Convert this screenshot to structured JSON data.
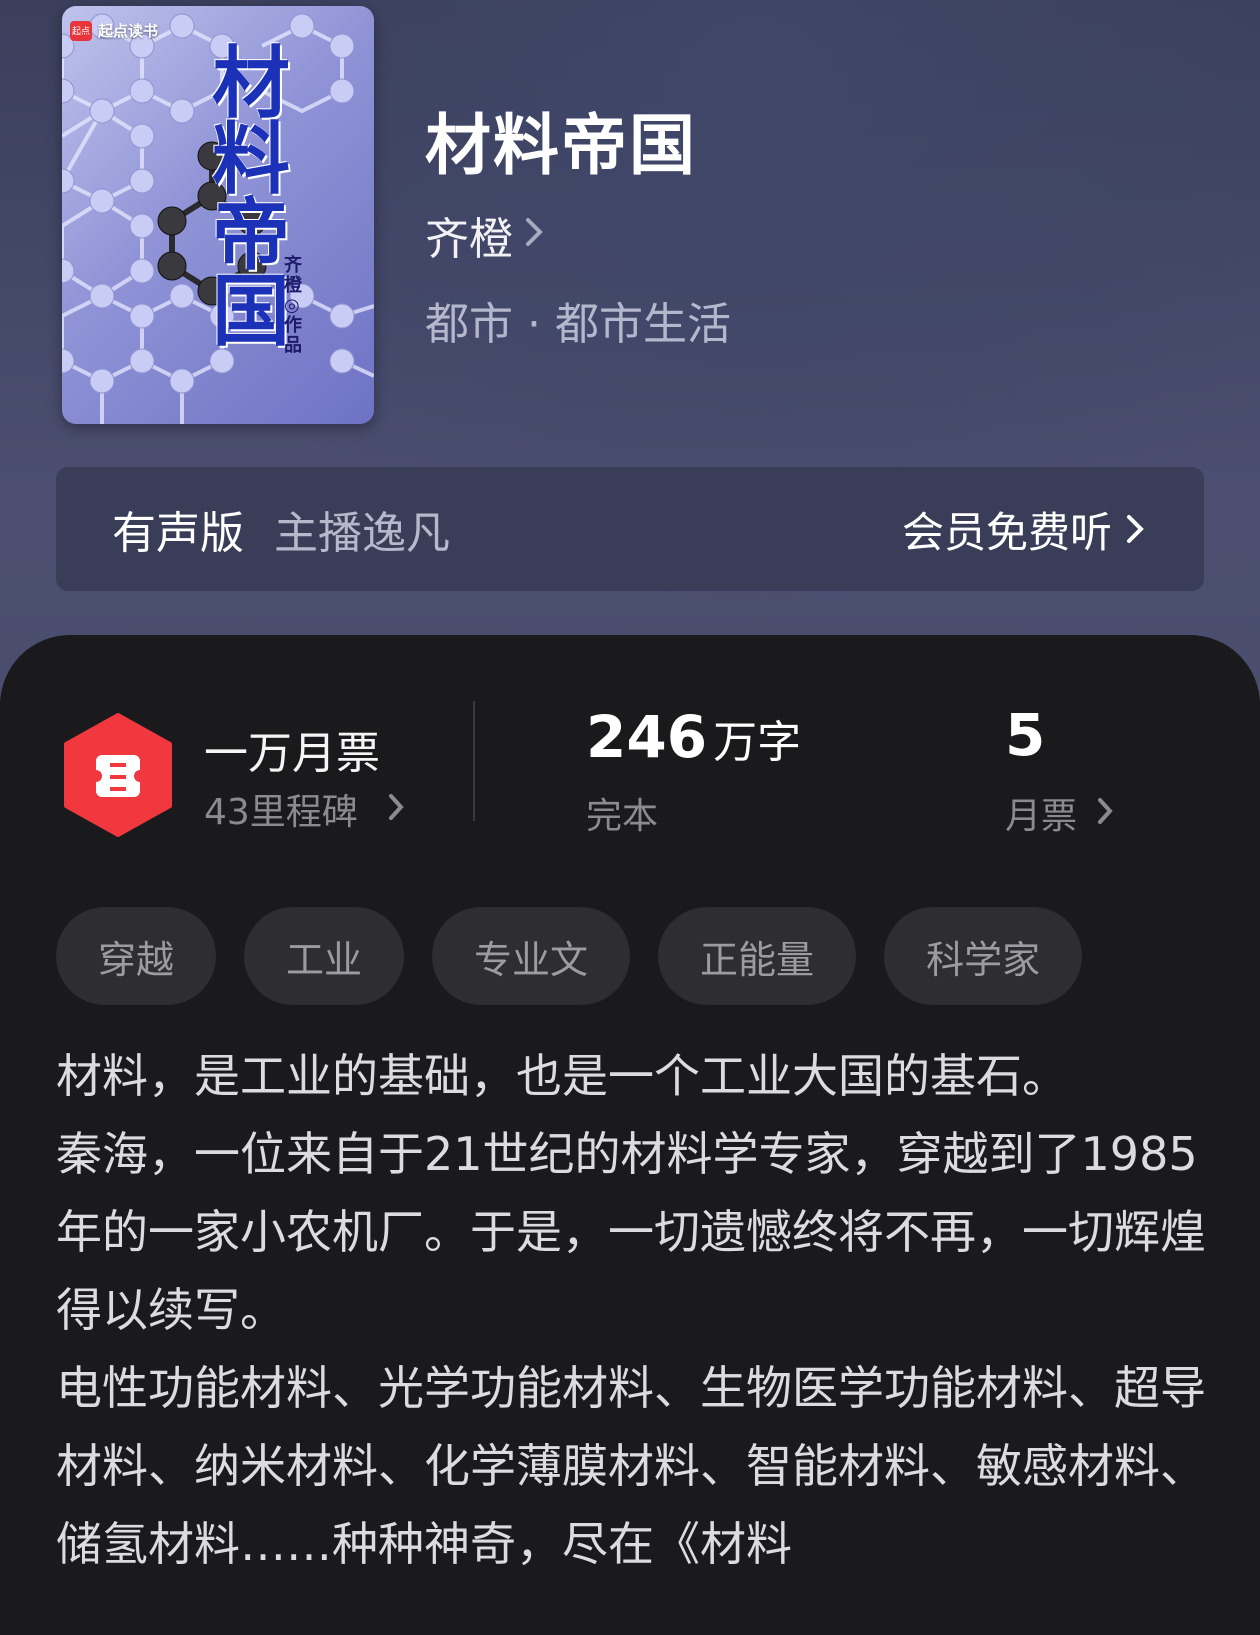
{
  "book": {
    "cover_brand": "起点读书",
    "cover_title": "材料帝国",
    "cover_author_caption": "齐橙◎作品",
    "title": "材料帝国",
    "author": "齐橙",
    "genre": "都市 · 都市生活"
  },
  "audio": {
    "label": "有声版",
    "narrator": "主播逸凡",
    "cta": "会员免费听"
  },
  "stats": {
    "monthly_rank_title": "一万月票",
    "milestones": "43里程碑",
    "word_count": "246",
    "word_unit": "万字",
    "status": "完本",
    "votes": "5",
    "votes_label": "月票"
  },
  "tags": [
    "穿越",
    "工业",
    "专业文",
    "正能量",
    "科学家"
  ],
  "description": [
    "材料，是工业的基础，也是一个工业大国的基石。",
    "秦海，一位来自于21世纪的材料学专家，穿越到了1985年的一家小农机厂。于是，一切遗憾终将不再，一切辉煌得以续写。",
    "电性功能材料、光学功能材料、生物医学功能材料、超导材料、纳米材料、化学薄膜材料、智能材料、敏感材料、储氢材料……种种神奇，尽在《材料"
  ],
  "colors": {
    "hero_bg": "#45496a",
    "panel_bg": "#1a1a1c",
    "ticket_red": "#f0383e",
    "tag_bg": "#2e2e31"
  }
}
